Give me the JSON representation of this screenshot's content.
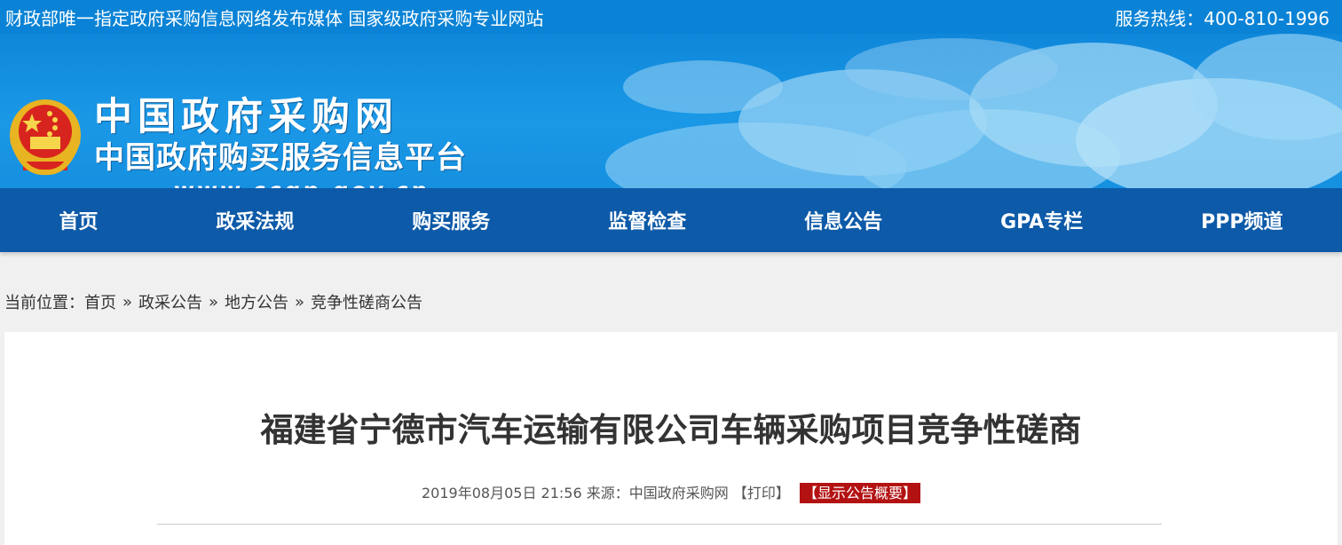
{
  "topbar": {
    "tagline": "财政部唯一指定政府采购信息网络发布媒体 国家级政府采购专业网站",
    "hotline": "服务热线：400-810-1996"
  },
  "banner": {
    "logo_line1": "中国政府采购网",
    "logo_line2": "中国政府购买服务信息平台",
    "logo_line3": "www.ccgp.gov.cn"
  },
  "nav": {
    "items": [
      "首页",
      "政采法规",
      "购买服务",
      "监督检查",
      "信息公告",
      "GPA专栏",
      "PPP频道"
    ]
  },
  "breadcrumb": {
    "prefix": "当前位置：",
    "items": [
      "首页",
      "政采公告",
      "地方公告",
      "竞争性磋商公告"
    ],
    "separator": "»"
  },
  "article": {
    "title": "福建省宁德市汽车运输有限公司车辆采购项目竞争性磋商",
    "date": "2019年08月05日 21:56",
    "source_label": "来源：",
    "source": "中国政府采购网",
    "print": "【打印】",
    "show_summary": "【显示公告概要】"
  },
  "colors": {
    "topbar": "#0a83d6",
    "nav": "#0d5aa8",
    "summary_badge": "#b31212"
  }
}
